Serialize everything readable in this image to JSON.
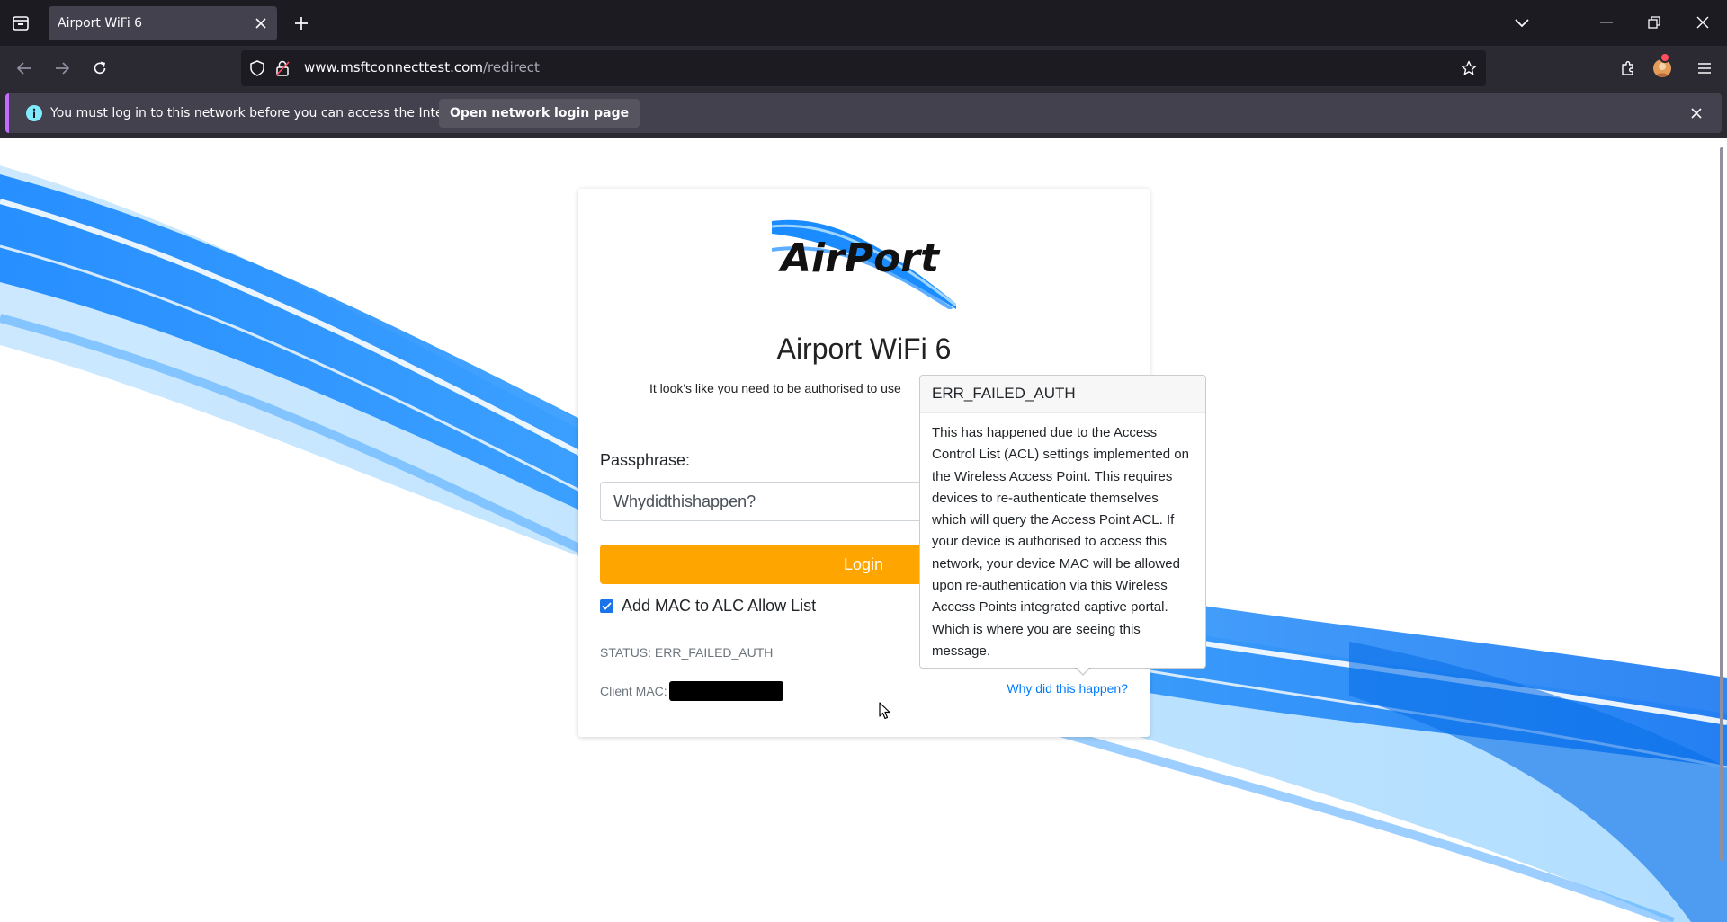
{
  "browser": {
    "tab_title": "Airport WiFi 6",
    "url_host": "www.msftconnecttest.com",
    "url_path": "/redirect"
  },
  "notification": {
    "message": "You must log in to this network before you can access the Internet.",
    "button_label": "Open network login page"
  },
  "page": {
    "logo_text": "AirPort",
    "title": "Airport WiFi 6",
    "subtitle": "It look's like you need to be authorised to use",
    "passphrase_label": "Passphrase:",
    "passphrase_value": "Whydidthishappen?",
    "login_label": "Login",
    "checkbox_label": "Add MAC to ALC Allow List",
    "checkbox_checked": true,
    "status_text": "STATUS: ERR_FAILED_AUTH",
    "client_mac_label": "Client MAC:",
    "why_link": "Why did this happen?"
  },
  "popover": {
    "title": "ERR_FAILED_AUTH",
    "body": "This has happened due to the Access Control List (ACL) settings implemented on the Wireless Access Point. This requires devices to re-authenticate themselves which will query the Access Point ACL. If your device is authorised to access this network, your device MAC will be allowed upon re-authentication via this Wireless Access Points integrated captive portal. Which is where you are seeing this message."
  },
  "colors": {
    "login_button": "#ffa500",
    "link": "#007bff",
    "browser_chrome": "#1c1b22",
    "wave_blue": "#1a8cff"
  }
}
